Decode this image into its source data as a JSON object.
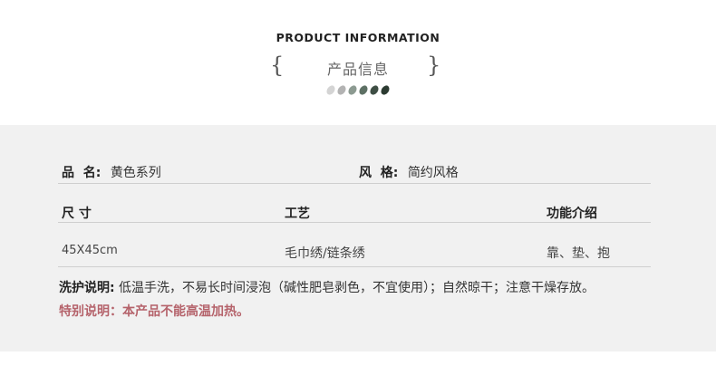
{
  "header": {
    "title_en": "PRODUCT INFORMATION",
    "title_cn": "产品信息",
    "brace_left": "{",
    "brace_right": "}"
  },
  "colors": {
    "dots": [
      "#d4d4d4",
      "#b3b3b3",
      "#8c9a91",
      "#5d7064",
      "#3e4e44",
      "#2b3a31"
    ],
    "panel_bg": "#f1f1f1",
    "warning": "#b5636b"
  },
  "info": {
    "name_label": "品  名:",
    "name_value": "黄色系列",
    "style_label": "风  格:",
    "style_value": "简约风格"
  },
  "table": {
    "headers": [
      "尺 寸",
      "工艺",
      "功能介绍"
    ],
    "row": [
      "45X45cm",
      "毛巾绣/链条绣",
      "靠、垫、抱"
    ]
  },
  "notes": {
    "care_label": "洗护说明:",
    "care_text": " 低温手洗，不易长时间浸泡（碱性肥皂剥色，不宜使用）；自然晾干；注意干燥存放。",
    "warning": "特别说明：本产品不能高温加热。"
  }
}
